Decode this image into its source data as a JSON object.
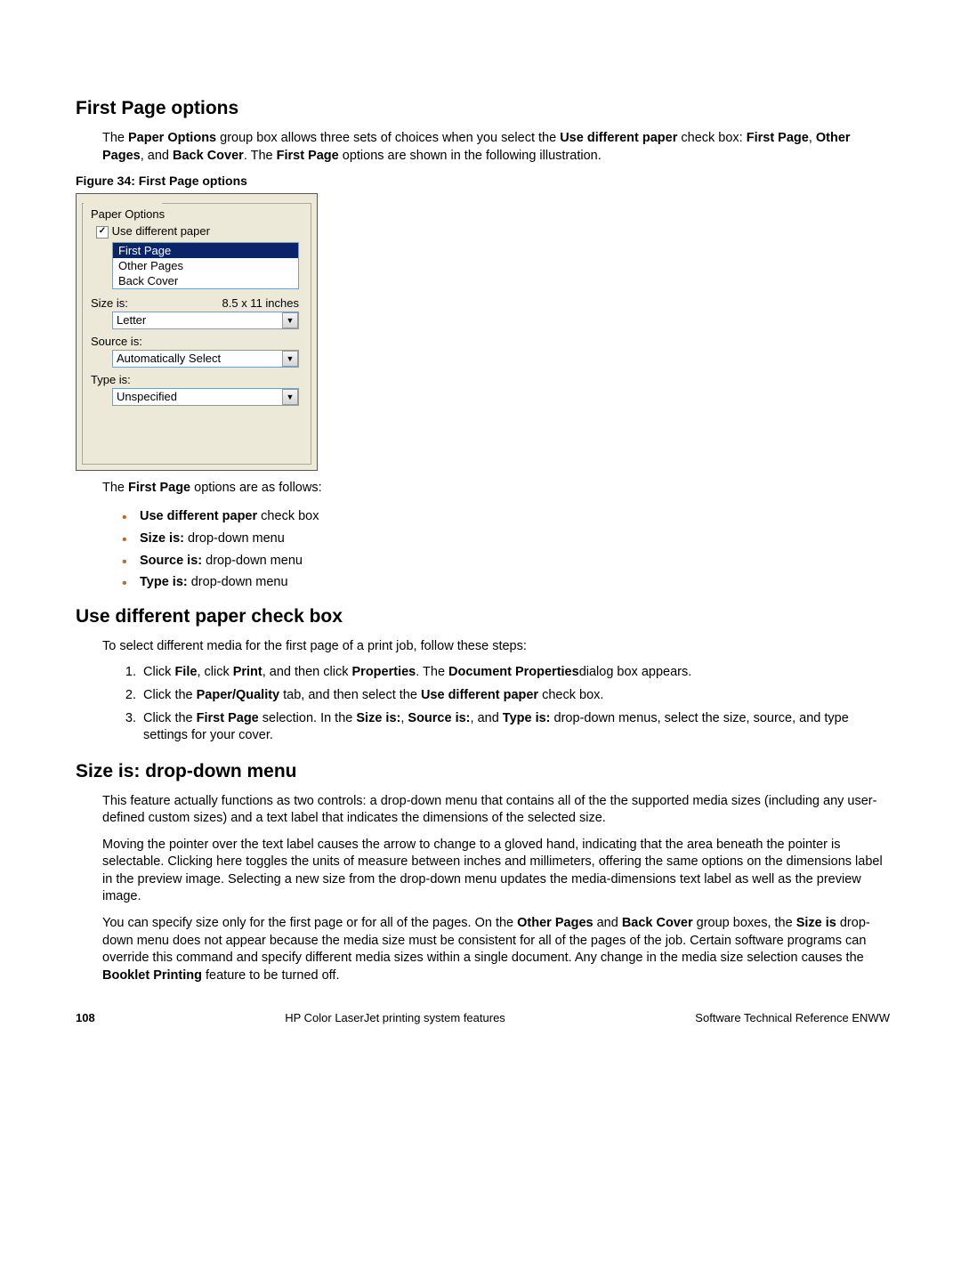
{
  "h1": "First Page options",
  "p1_a": "The ",
  "p1_b": "Paper Options",
  "p1_c": " group box allows three sets of choices when you select the ",
  "p1_d": "Use different paper",
  "p1_e": " check box: ",
  "p1_f": "First Page",
  "p1_g": ", ",
  "p1_h": "Other Pages",
  "p1_i": ", and ",
  "p1_j": "Back Cover",
  "p1_k": ". The ",
  "p1_l": "First Page",
  "p1_m": " options are shown in the following illustration.",
  "figcap": "Figure 34: First Page options",
  "shot": {
    "legend": "Paper Options",
    "checkbox_label": "Use different paper",
    "checkbox_mark": "✓",
    "list": [
      "First Page",
      "Other Pages",
      "Back Cover"
    ],
    "size_label": "Size is:",
    "size_dim": "8.5 x 11 inches",
    "size_val": "Letter",
    "source_label": "Source is:",
    "source_val": "Automatically Select",
    "type_label": "Type is:",
    "type_val": "Unspecified",
    "arrow": "▼"
  },
  "p2_a": "The ",
  "p2_b": "First Page ",
  "p2_c": " options are as follows:",
  "bul": [
    {
      "b": "Use different paper",
      "t": " check box"
    },
    {
      "b": "Size is:",
      "t": " drop-down menu"
    },
    {
      "b": "Source is:",
      "t": " drop-down menu"
    },
    {
      "b": "Type is:",
      "t": " drop-down menu"
    }
  ],
  "h2": "Use different paper check box",
  "p3": "To select different media for the first page of a print job, follow these steps:",
  "step1_a": "Click ",
  "step1_b": "File",
  "step1_c": ", click ",
  "step1_d": "Print",
  "step1_e": ", and then click ",
  "step1_f": "Properties",
  "step1_g": ". The ",
  "step1_h": "Document Properties",
  "step1_i": "dialog box appears.",
  "step2_a": "Click the ",
  "step2_b": "Paper/Quality",
  "step2_c": " tab, and then select the ",
  "step2_d": "Use different paper",
  "step2_e": " check box.",
  "step3_a": "Click the ",
  "step3_b": "First Page",
  "step3_c": " selection. In the ",
  "step3_d": "Size is:",
  "step3_e": ", ",
  "step3_f": "Source is:",
  "step3_g": ", and ",
  "step3_h": "Type is:",
  "step3_i": " drop-down menus, select the size, source, and type settings for your cover.",
  "h3": "Size is: drop-down menu",
  "p4": "This feature actually functions as two controls: a drop-down menu that contains all of the the supported media sizes (including any user-defined custom sizes) and a text label that indicates the dimensions of the selected size.",
  "p5": "Moving the pointer over the text label causes the arrow to change to a gloved hand, indicating that the area beneath the pointer is selectable. Clicking here toggles the units of measure between inches and millimeters, offering the same options on the dimensions label in the preview image. Selecting a new size from the drop-down menu updates the media-dimensions text label as well as the preview image.",
  "p6_a": "You can specify size only for the first page or for all of the pages. On the ",
  "p6_b": "Other Pages",
  "p6_c": " and ",
  "p6_d": "Back Cover",
  "p6_e": " group boxes, the ",
  "p6_f": "Size is",
  "p6_g": " drop-down menu does not appear because the media size must be consistent for all of the pages of the job. Certain software programs can override this command and specify different media sizes within a single document. Any change in the media size selection causes the ",
  "p6_h": "Booklet Printing",
  "p6_i": " feature to be turned off.",
  "footer": {
    "page": "108",
    "center": "HP Color LaserJet printing system features",
    "right": "Software Technical Reference ENWW"
  }
}
